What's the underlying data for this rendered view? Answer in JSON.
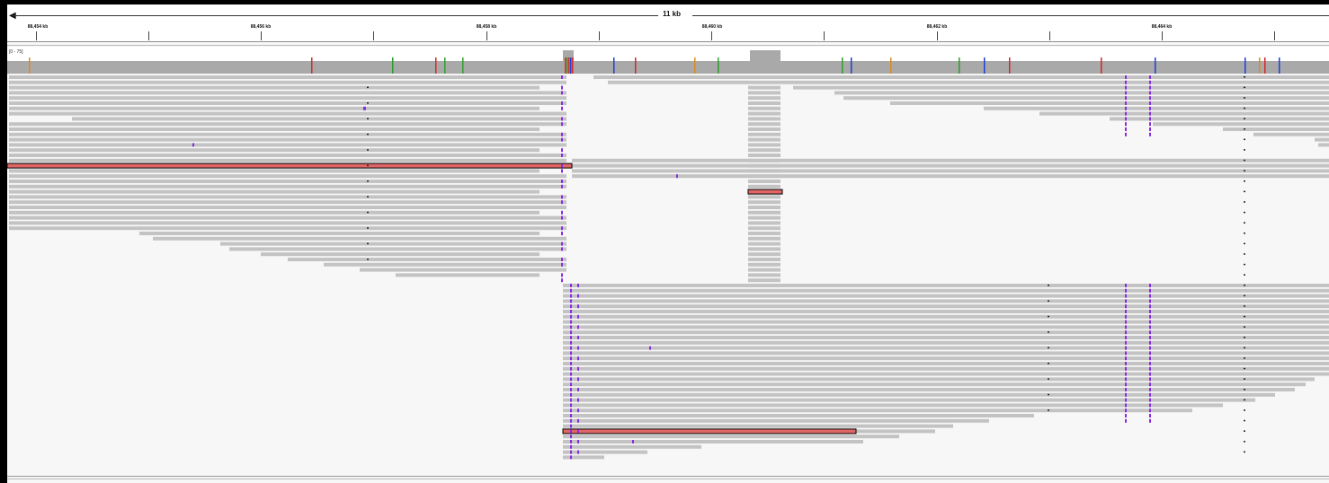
{
  "ruler": {
    "span_label": "11 kb",
    "ticks": [
      "88,454 kb",
      "88,456 kb",
      "88,458 kb",
      "88,460 kb",
      "88,462 kb",
      "88,464 kb"
    ]
  },
  "coverage": {
    "range_label": "[0 - 75]"
  },
  "colors": {
    "read": "#c3c3c3",
    "read_highlight": "#e06666",
    "coverage": "#a9a9a9",
    "insertion": "#8a2be2",
    "mismatch_red": "#d62728",
    "mismatch_green": "#2ca02c",
    "mismatch_blue": "#1f3fd6",
    "mismatch_orange": "#e08a1e"
  }
}
